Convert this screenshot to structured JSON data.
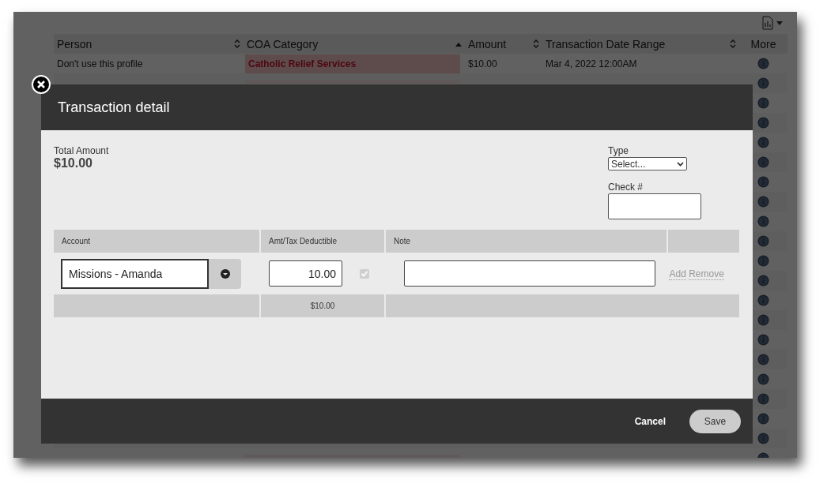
{
  "grid": {
    "columns": [
      {
        "label": "Person",
        "sortable": true,
        "sorted_ascending": false
      },
      {
        "label": "COA Category",
        "sortable": true,
        "sorted_ascending": true
      },
      {
        "label": "Amount",
        "sortable": true,
        "sorted_ascending": false
      },
      {
        "label": "Transaction Date Range",
        "sortable": true,
        "sorted_ascending": false
      },
      {
        "label": "More",
        "sortable": false
      }
    ],
    "rows": [
      {
        "person": "Don't use this profile",
        "category": "Catholic Relief Services",
        "amount": "$10.00",
        "date": "Mar 4, 2022 12:00AM"
      },
      {},
      {},
      {},
      {},
      {},
      {},
      {},
      {},
      {},
      {},
      {},
      {},
      {},
      {},
      {},
      {},
      {},
      {},
      {},
      {}
    ]
  },
  "modal": {
    "title": "Transaction detail",
    "total_label": "Total Amount",
    "total": "$10.00",
    "type": {
      "label": "Type",
      "value": "Select..."
    },
    "check": {
      "label": "Check #"
    },
    "columns": [
      "Account",
      "Amt/Tax Deductible",
      "Note"
    ],
    "lines": [
      {
        "account": "Missions - Amanda",
        "amount": "10.00",
        "tax_deductible": true,
        "add": "Add",
        "remove": "Remove"
      }
    ],
    "footer_total": "$10.00",
    "cancel": "Cancel",
    "save": "Save"
  }
}
